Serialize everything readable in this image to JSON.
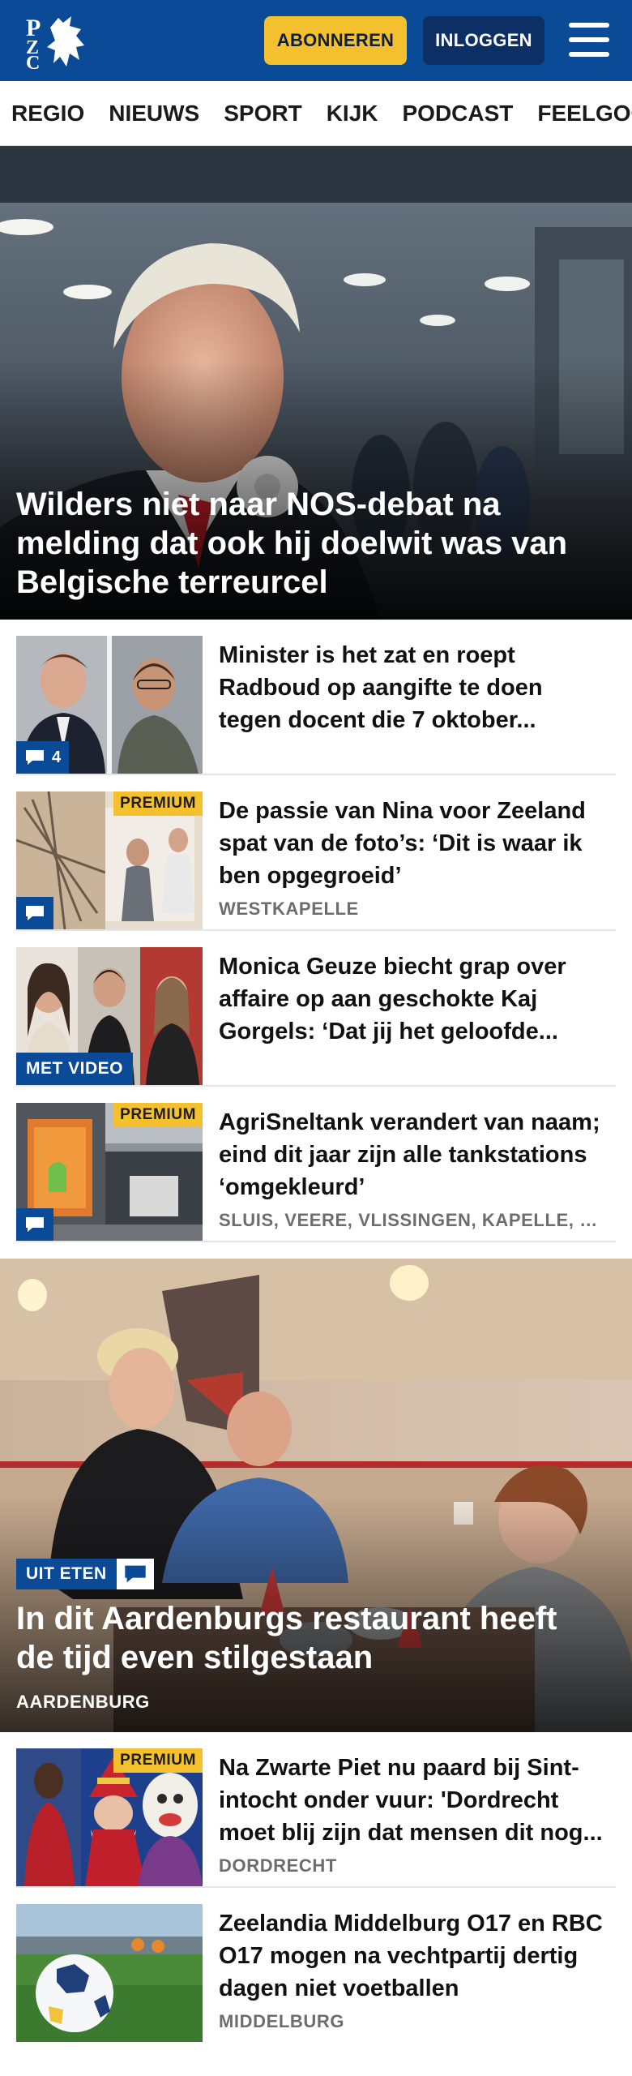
{
  "header": {
    "logo_letters": "PZC",
    "subscribe_label": "ABONNEREN",
    "login_label": "INLOGGEN",
    "menu_icon": "hamburger-icon",
    "brand_color": "#0a4a96",
    "accent_color": "#f5c02e"
  },
  "nav": {
    "items": [
      "REGIO",
      "NIEUWS",
      "SPORT",
      "KIJK",
      "PODCAST",
      "FEELGOOD"
    ]
  },
  "hero": {
    "title": "Wilders niet naar NOS-debat na melding dat ook hij doelwit was van Belgische terreurcel"
  },
  "articles": [
    {
      "title": "Minister is het zat en roept Radboud op aangifte te doen tegen docent die 7 oktober...",
      "location": "",
      "premium": false,
      "comment_count": "4",
      "video": false
    },
    {
      "title": "De passie van Nina voor Zeeland spat van de foto’s: ‘Dit is waar ik ben opgegroeid’",
      "location": "WESTKAPELLE",
      "premium": true,
      "premium_label": "PREMIUM",
      "comment_count": "",
      "video": false
    },
    {
      "title": "Monica Geuze biecht grap over affaire op aan geschokte Kaj Gorgels: ‘Dat jij het geloofde...",
      "location": "",
      "premium": false,
      "video": true,
      "video_label": "MET VIDEO"
    },
    {
      "title": "AgriSneltank verandert van naam; eind dit jaar zijn alle tankstations ‘omgekleurd’",
      "location": "SLUIS, VEERE, VLISSINGEN, KAPELLE, GOES",
      "premium": true,
      "premium_label": "PREMIUM",
      "comment_count": "",
      "video": false
    }
  ],
  "feature": {
    "tag": "UIT ETEN",
    "title": "In dit Aardenburgs restaurant heeft de tijd even stilgestaan",
    "location": "AARDENBURG"
  },
  "articles2": [
    {
      "title": "Na Zwarte Piet nu paard bij Sint-intocht onder vuur: 'Dordrecht moet blij zijn dat mensen dit nog...",
      "location": "DORDRECHT",
      "premium": true,
      "premium_label": "PREMIUM"
    },
    {
      "title": "Zeelandia Middelburg O17 en RBC O17 mogen na vechtpartij dertig dagen niet voetballen",
      "location": "MIDDELBURG",
      "premium": false
    }
  ]
}
